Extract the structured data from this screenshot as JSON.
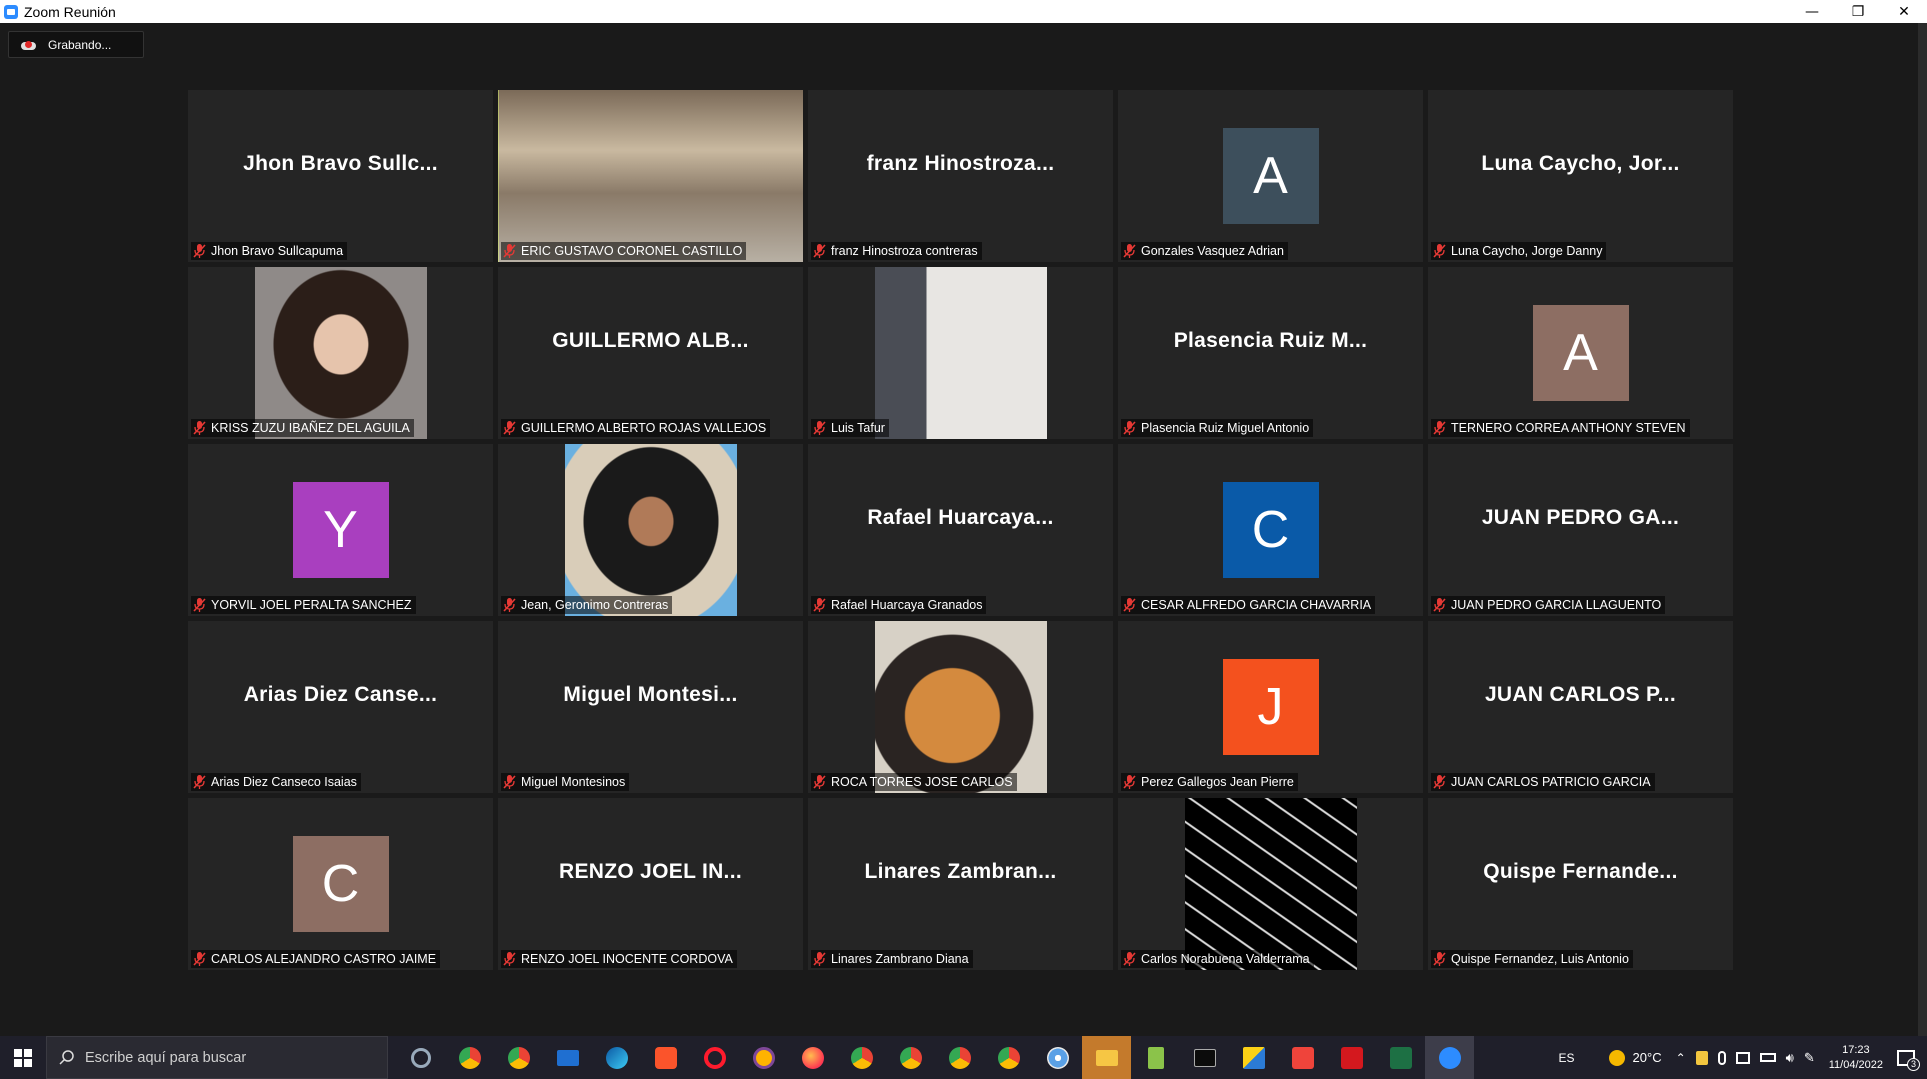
{
  "window": {
    "title": "Zoom Reunión",
    "minimize": "—",
    "restore": "❐",
    "close": "✕"
  },
  "recording": {
    "label": "Grabando..."
  },
  "tiles": [
    {
      "type": "name",
      "big": "Jhon  Bravo  Sullc...",
      "label": "Jhon Bravo Sullcapuma"
    },
    {
      "type": "video",
      "big": "",
      "label": "ERIC GUSTAVO CORONEL CASTILLO",
      "active": true
    },
    {
      "type": "name",
      "big": "franz  Hinostroza...",
      "label": "franz Hinostroza contreras"
    },
    {
      "type": "avatar",
      "big": "A",
      "color": "#3d4f5c",
      "label": "Gonzales Vasquez Adrian"
    },
    {
      "type": "name",
      "big": "Luna  Caycho,  Jor...",
      "label": "Luna Caycho, Jorge Danny"
    },
    {
      "type": "video",
      "big": "",
      "label": "KRISS ZUZU IBAÑEZ DEL AGUILA"
    },
    {
      "type": "name",
      "big": "GUILLERMO  ALB...",
      "label": "GUILLERMO ALBERTO ROJAS VALLEJOS"
    },
    {
      "type": "video",
      "big": "",
      "label": "Luis Tafur"
    },
    {
      "type": "name",
      "big": "Plasencia  Ruiz  M...",
      "label": "Plasencia Ruiz Miguel Antonio"
    },
    {
      "type": "avatar",
      "big": "A",
      "color": "#8d6e63",
      "label": "TERNERO CORREA ANTHONY STEVEN"
    },
    {
      "type": "avatar",
      "big": "Y",
      "color": "#a93fbf",
      "label": "YORVIL JOEL PERALTA SANCHEZ"
    },
    {
      "type": "video",
      "big": "",
      "label": "Jean, Geronimo Contreras"
    },
    {
      "type": "name",
      "big": "Rafael  Huarcaya...",
      "label": "Rafael Huarcaya Granados"
    },
    {
      "type": "avatar",
      "big": "C",
      "color": "#0a5aa8",
      "label": "CESAR ALFREDO GARCIA CHAVARRIA"
    },
    {
      "type": "name",
      "big": "JUAN  PEDRO  GA...",
      "label": "JUAN PEDRO GARCIA LLAGUENTO"
    },
    {
      "type": "name",
      "big": "Arias  Diez  Canse...",
      "label": "Arias Diez Canseco Isaias"
    },
    {
      "type": "name",
      "big": "Miguel  Montesi...",
      "label": "Miguel Montesinos"
    },
    {
      "type": "video",
      "big": "",
      "label": "ROCA TORRES JOSE CARLOS"
    },
    {
      "type": "avatar",
      "big": "J",
      "color": "#f4511e",
      "label": "Perez Gallegos Jean Pierre"
    },
    {
      "type": "name",
      "big": "JUAN  CARLOS  P...",
      "label": "JUAN CARLOS PATRICIO GARCIA"
    },
    {
      "type": "avatar",
      "big": "C",
      "color": "#8d6e63",
      "label": "CARLOS ALEJANDRO CASTRO JAIME"
    },
    {
      "type": "name",
      "big": "RENZO  JOEL  IN...",
      "label": "RENZO JOEL INOCENTE CORDOVA"
    },
    {
      "type": "name",
      "big": "Linares  Zambran...",
      "label": "Linares Zambrano Diana"
    },
    {
      "type": "video",
      "big": "",
      "label": "Carlos Norabuena Valderrama"
    },
    {
      "type": "name",
      "big": "Quispe  Fernande...",
      "label": "Quispe Fernandez, Luis Antonio"
    }
  ],
  "taskbar": {
    "search_placeholder": "Escribe aquí para buscar",
    "language": "ES",
    "temperature": "20°C",
    "time": "17:23",
    "date": "11/04/2022",
    "notifications": "3"
  }
}
